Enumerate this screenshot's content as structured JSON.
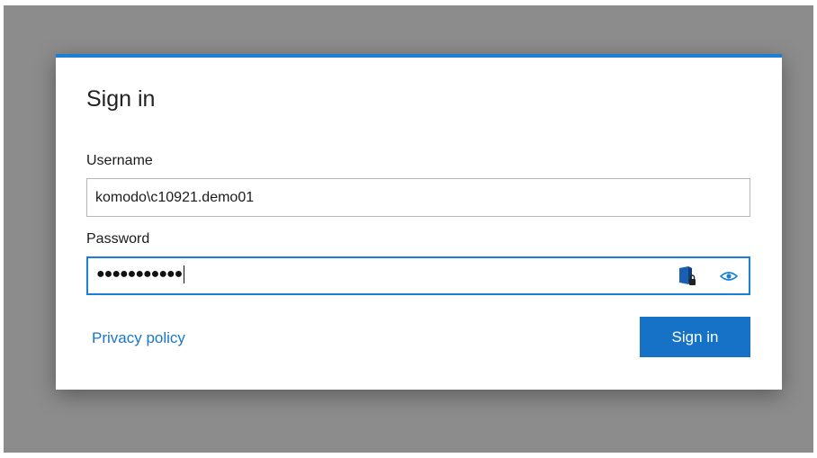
{
  "dialog": {
    "title": "Sign in",
    "accent_color": "#1a7fd6"
  },
  "username": {
    "label": "Username",
    "value": "komodo\\c10921.demo01"
  },
  "password": {
    "label": "Password",
    "masked_value": "●●●●●●●●●●●",
    "icons": [
      "password-manager-key-icon",
      "show-password-eye-icon"
    ]
  },
  "footer": {
    "privacy_link": "Privacy policy",
    "signin_button": "Sign in"
  }
}
